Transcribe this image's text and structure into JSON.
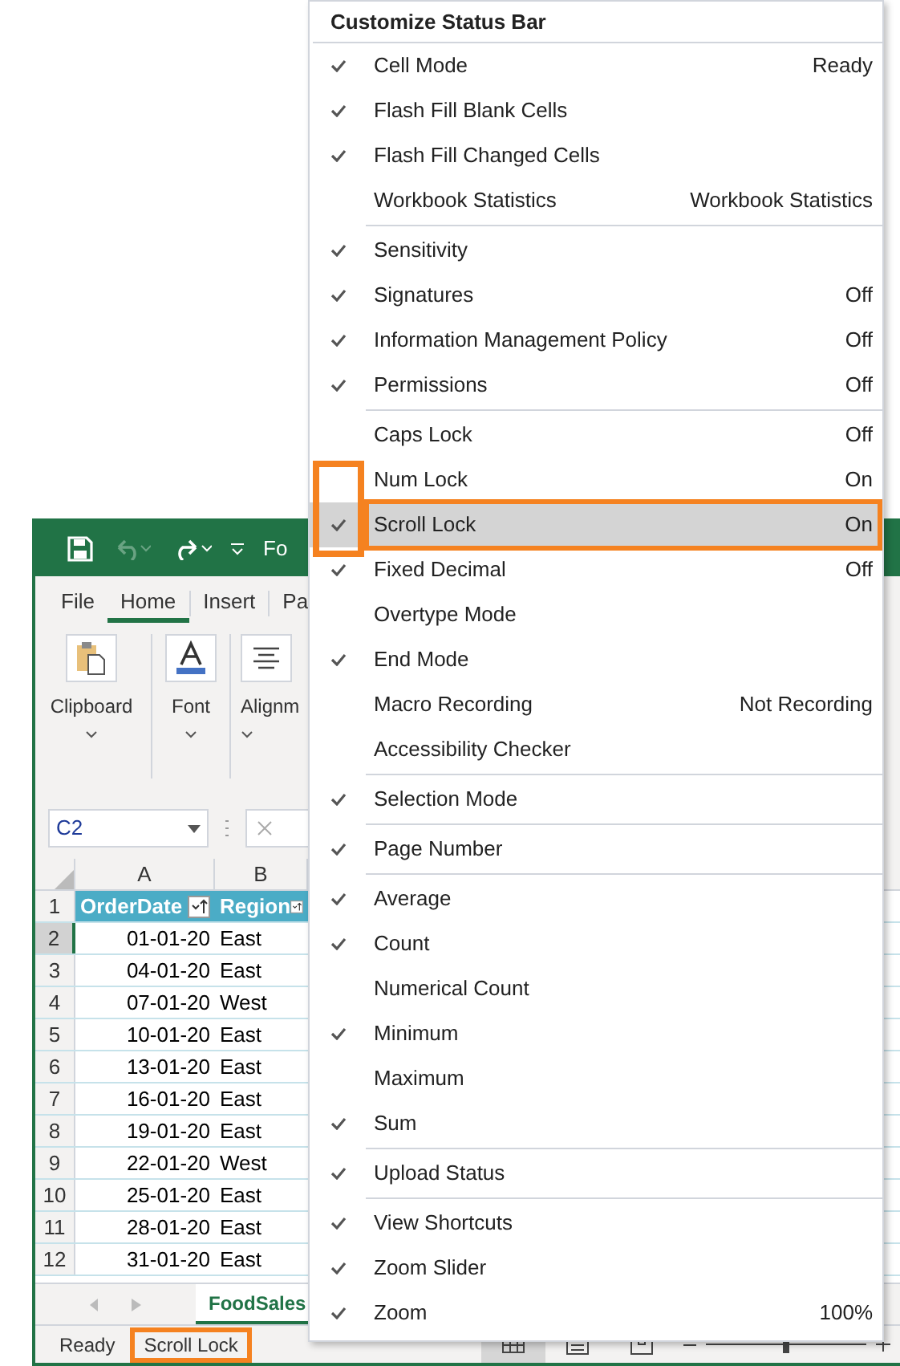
{
  "window": {
    "title": "Fo"
  },
  "ribbon": {
    "tabs": [
      {
        "label": "File",
        "selected": false
      },
      {
        "label": "Home",
        "selected": true
      },
      {
        "label": "Insert",
        "selected": false
      },
      {
        "label": "Pa",
        "selected": false
      }
    ],
    "groups": [
      {
        "kind": "clipboard",
        "label": "Clipboard"
      },
      {
        "kind": "font",
        "label": "Font"
      },
      {
        "kind": "alignment",
        "label": "Alignm"
      }
    ]
  },
  "name_box": {
    "value": "C2"
  },
  "sheet": {
    "columns": [
      "A",
      "B"
    ],
    "rows": [
      {
        "number": "1",
        "cells": [
          "OrderDate",
          "Region"
        ],
        "header": true,
        "selected": false
      },
      {
        "number": "2",
        "cells": [
          "01-01-20",
          "East"
        ],
        "header": false,
        "selected": true
      },
      {
        "number": "3",
        "cells": [
          "04-01-20",
          "East"
        ],
        "header": false,
        "selected": false
      },
      {
        "number": "4",
        "cells": [
          "07-01-20",
          "West"
        ],
        "header": false,
        "selected": false
      },
      {
        "number": "5",
        "cells": [
          "10-01-20",
          "East"
        ],
        "header": false,
        "selected": false
      },
      {
        "number": "6",
        "cells": [
          "13-01-20",
          "East"
        ],
        "header": false,
        "selected": false
      },
      {
        "number": "7",
        "cells": [
          "16-01-20",
          "East"
        ],
        "header": false,
        "selected": false
      },
      {
        "number": "8",
        "cells": [
          "19-01-20",
          "East"
        ],
        "header": false,
        "selected": false
      },
      {
        "number": "9",
        "cells": [
          "22-01-20",
          "West"
        ],
        "header": false,
        "selected": false
      },
      {
        "number": "10",
        "cells": [
          "25-01-20",
          "East"
        ],
        "header": false,
        "selected": false
      },
      {
        "number": "11",
        "cells": [
          "28-01-20",
          "East"
        ],
        "header": false,
        "selected": false
      },
      {
        "number": "12",
        "cells": [
          "31-01-20",
          "East"
        ],
        "header": false,
        "selected": false
      }
    ]
  },
  "sheet_tabs": [
    {
      "label": "FoodSales",
      "selected": true
    }
  ],
  "status_bar": {
    "items": [
      {
        "text": "Ready",
        "highlighted": false
      },
      {
        "text": "Scroll Lock",
        "highlighted": true
      }
    ],
    "zoom": {
      "level": 0.5
    }
  },
  "menu": {
    "title": "Customize Status Bar",
    "groups": [
      [
        {
          "label": "Cell Mode",
          "value": "Ready",
          "checked": true,
          "highlighted": false
        },
        {
          "label": "Flash Fill Blank Cells",
          "checked": true,
          "highlighted": false
        },
        {
          "label": "Flash Fill Changed Cells",
          "checked": true,
          "highlighted": false
        },
        {
          "label": "Workbook Statistics",
          "value": "Workbook Statistics",
          "checked": false,
          "highlighted": false
        }
      ],
      [
        {
          "label": "Sensitivity",
          "checked": true,
          "highlighted": false
        },
        {
          "label": "Signatures",
          "value": "Off",
          "checked": true,
          "highlighted": false
        },
        {
          "label": "Information Management Policy",
          "value": "Off",
          "checked": true,
          "highlighted": false
        },
        {
          "label": "Permissions",
          "value": "Off",
          "checked": true,
          "highlighted": false
        }
      ],
      [
        {
          "label": "Caps Lock",
          "value": "Off",
          "checked": false,
          "highlighted": false
        },
        {
          "label": "Num Lock",
          "value": "On",
          "checked": false,
          "highlighted": false
        },
        {
          "label": "Scroll Lock",
          "value": "On",
          "checked": true,
          "highlighted": true
        },
        {
          "label": "Fixed Decimal",
          "value": "Off",
          "checked": true,
          "highlighted": false
        },
        {
          "label": "Overtype Mode",
          "checked": false,
          "highlighted": false
        },
        {
          "label": "End Mode",
          "checked": true,
          "highlighted": false
        },
        {
          "label": "Macro Recording",
          "value": "Not Recording",
          "checked": false,
          "highlighted": false
        },
        {
          "label": "Accessibility Checker",
          "checked": false,
          "highlighted": false
        }
      ],
      [
        {
          "label": "Selection Mode",
          "checked": true,
          "highlighted": false
        }
      ],
      [
        {
          "label": "Page Number",
          "checked": true,
          "highlighted": false
        }
      ],
      [
        {
          "label": "Average",
          "checked": true,
          "highlighted": false
        },
        {
          "label": "Count",
          "checked": true,
          "highlighted": false
        },
        {
          "label": "Numerical Count",
          "checked": false,
          "highlighted": false
        },
        {
          "label": "Minimum",
          "checked": true,
          "highlighted": false
        },
        {
          "label": "Maximum",
          "checked": false,
          "highlighted": false
        },
        {
          "label": "Sum",
          "checked": true,
          "highlighted": false
        }
      ],
      [
        {
          "label": "Upload Status",
          "checked": true,
          "highlighted": false
        }
      ],
      [
        {
          "label": "View Shortcuts",
          "checked": true,
          "highlighted": false
        },
        {
          "label": "Zoom Slider",
          "checked": true,
          "highlighted": false
        },
        {
          "label": "Zoom",
          "value": "100%",
          "checked": true,
          "highlighted": false
        }
      ]
    ]
  }
}
